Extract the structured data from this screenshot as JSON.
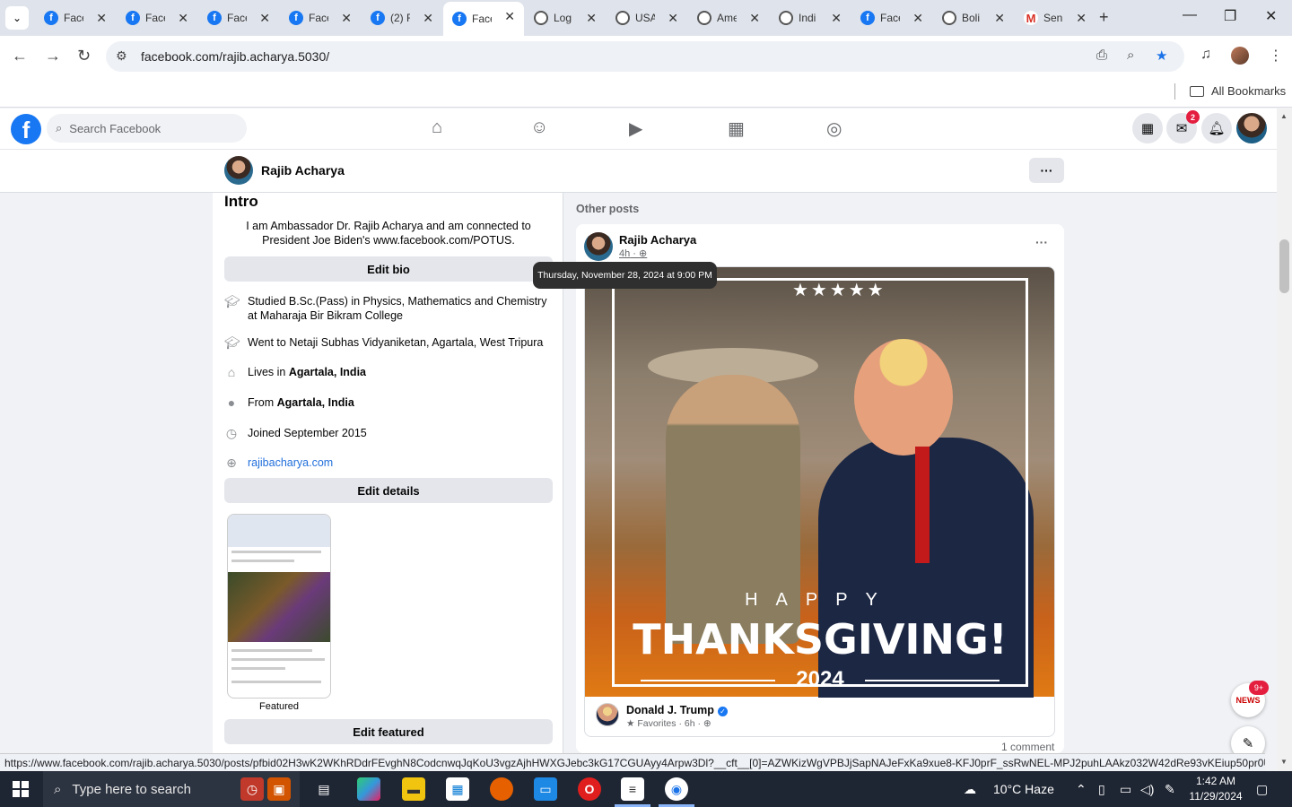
{
  "browser": {
    "tabs": [
      {
        "title": "Face",
        "icon": "facebook-icon"
      },
      {
        "title": "Face",
        "icon": "facebook-icon"
      },
      {
        "title": "Face",
        "icon": "facebook-icon"
      },
      {
        "title": "Face",
        "icon": "facebook-icon"
      },
      {
        "title": "(2) F",
        "icon": "facebook-icon"
      },
      {
        "title": "Face",
        "icon": "facebook-icon",
        "active": true
      },
      {
        "title": "Log",
        "icon": "globe-icon"
      },
      {
        "title": "USA",
        "icon": "globe-icon"
      },
      {
        "title": "Ame",
        "icon": "globe-icon"
      },
      {
        "title": "Indi",
        "icon": "globe-icon"
      },
      {
        "title": "Face",
        "icon": "facebook-icon"
      },
      {
        "title": "Boli",
        "icon": "globe-icon"
      },
      {
        "title": "Sen",
        "icon": "gmail-icon"
      }
    ],
    "url": "facebook.com/rajib.acharya.5030/",
    "bookmarks_folder": "All Bookmarks",
    "status_url": "https://www.facebook.com/rajib.acharya.5030/posts/pfbid02H3wK2WKhRDdrFEvghN8CodcnwqJqKoU3vgzAjhHWXGJebc3kG17CGUAyy4Arpw3Dl?__cft__[0]=AZWKizWgVPBJjSapNAJeFxKa9xue8-KFJ0prF_ssRwNEL-MPJ2puhLAAkz032W42dRe93vKEiup50pr0UT4odP..."
  },
  "facebook": {
    "search_placeholder": "Search Facebook",
    "messenger_badge": "2",
    "profile_name": "Rajib Acharya",
    "more_label": "···"
  },
  "intro": {
    "heading": "Intro",
    "bio": "I am Ambassador Dr. Rajib Acharya and am connected to President Joe Biden's www.facebook.com/POTUS.",
    "edit_bio": "Edit bio",
    "details": [
      {
        "icon": "graduation-cap-icon",
        "text": "Studied B.Sc.(Pass) in Physics, Mathematics and Chemistry at Maharaja Bir Bikram College"
      },
      {
        "icon": "graduation-cap-icon",
        "text": "Went to Netaji Subhas Vidyaniketan, Agartala, West Tripura"
      },
      {
        "icon": "home-icon",
        "prefix": "Lives in ",
        "bold": "Agartala, India"
      },
      {
        "icon": "location-pin-icon",
        "prefix": "From ",
        "bold": "Agartala, India"
      },
      {
        "icon": "clock-icon",
        "text": "Joined September 2015"
      },
      {
        "icon": "globe-icon",
        "link": "rajibacharya.com"
      }
    ],
    "edit_details": "Edit details",
    "featured_label": "Featured",
    "edit_featured": "Edit featured"
  },
  "posts": {
    "heading": "Other posts",
    "author": "Rajib Acharya",
    "time": "4h",
    "tooltip": "Thursday, November 28, 2024 at 9:00 PM",
    "image": {
      "stars": "★★★★★",
      "happy": "HAPPY",
      "headline": "THANKSGIVING!",
      "year": "2024"
    },
    "shared_from": "Donald J. Trump",
    "shared_meta": "Favorites · 6h ·",
    "comments": "1 comment",
    "news_badge": "9+",
    "news_label": "NEWS"
  },
  "taskbar": {
    "search_placeholder": "Type here to search",
    "weather": "10°C  Haze",
    "time": "1:42 AM",
    "date": "11/29/2024"
  }
}
